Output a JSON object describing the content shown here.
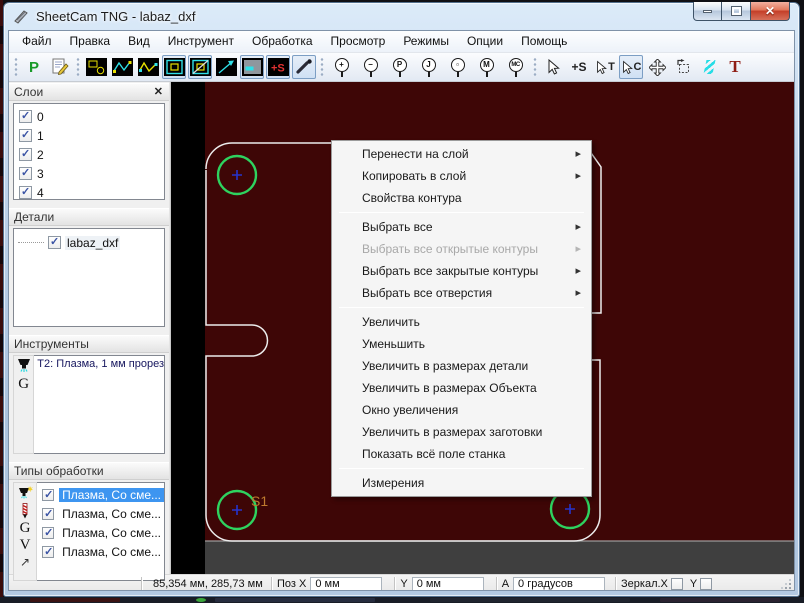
{
  "window": {
    "title": "SheetCam TNG - labaz_dxf"
  },
  "menu_bar": [
    "Файл",
    "Правка",
    "Вид",
    "Инструмент",
    "Обработка",
    "Просмотр",
    "Режимы",
    "Опции",
    "Помощь"
  ],
  "toolbar": {
    "post_label": "P",
    "pierce_s_label": "+S",
    "zoom_tools": [
      {
        "name": "zoom-in",
        "glyph": "+"
      },
      {
        "name": "zoom-out",
        "glyph": "−"
      },
      {
        "name": "zoom-part",
        "glyph": "P"
      },
      {
        "name": "zoom-job",
        "glyph": "J"
      },
      {
        "name": "zoom-window",
        "glyph": "▫"
      },
      {
        "name": "zoom-material",
        "glyph": "M"
      },
      {
        "name": "zoom-machine",
        "glyph": "MC"
      }
    ],
    "select_t_label": "T",
    "select_c_label": "C",
    "select_s_label": "+S",
    "text_tool_label": "T"
  },
  "panels": {
    "layers": {
      "title": "Слои",
      "items": [
        {
          "label": "0",
          "checked": true
        },
        {
          "label": "1",
          "checked": true
        },
        {
          "label": "2",
          "checked": true
        },
        {
          "label": "3",
          "checked": true
        },
        {
          "label": "4",
          "checked": true
        }
      ]
    },
    "parts": {
      "title": "Детали",
      "items": [
        {
          "label": "labaz_dxf",
          "checked": true
        }
      ]
    },
    "tools": {
      "title": "Инструменты",
      "g_label": "G",
      "items": [
        {
          "label": "T2: Плазма, 1 мм прорез"
        }
      ]
    },
    "operations": {
      "title": "Типы обработки",
      "g_label": "G",
      "v_label": "V",
      "arrow_label": "↗",
      "items": [
        {
          "label": "Плазма, Со сме...",
          "checked": true,
          "selected": true
        },
        {
          "label": "Плазма, Со сме...",
          "checked": true,
          "selected": false
        },
        {
          "label": "Плазма, Со сме...",
          "checked": true,
          "selected": false
        },
        {
          "label": "Плазма, Со сме...",
          "checked": true,
          "selected": false
        }
      ]
    }
  },
  "context_menu": {
    "items": [
      {
        "label": "Перенести на слой",
        "submenu": true
      },
      {
        "label": "Копировать в слой",
        "submenu": true
      },
      {
        "label": "Свойства контура",
        "submenu": false
      },
      {
        "label": "Выбрать все",
        "submenu": true
      },
      {
        "label": "Выбрать все открытые контуры",
        "submenu": true,
        "disabled": true
      },
      {
        "label": "Выбрать все закрытые контуры",
        "submenu": true
      },
      {
        "label": "Выбрать все отверстия",
        "submenu": true
      },
      {
        "label": "Увеличить",
        "submenu": false
      },
      {
        "label": "Уменьшить",
        "submenu": false
      },
      {
        "label": "Увеличить в размерах детали",
        "submenu": false
      },
      {
        "label": "Увеличить в размерах Объекта",
        "submenu": false
      },
      {
        "label": "Окно увеличения",
        "submenu": false
      },
      {
        "label": "Увеличить в размерах заготовки",
        "submenu": false
      },
      {
        "label": "Показать всё поле станка",
        "submenu": false
      },
      {
        "label": "Измерения",
        "submenu": false
      }
    ]
  },
  "canvas": {
    "start_point_label": "S1",
    "colors": {
      "material_bg": "#3e0606",
      "outside_left": "#000000",
      "outside_bottom": "#3f3f3f",
      "part_outline": "#ececec",
      "pierce_circle": "#2ed35f",
      "pierce_cross": "#2633cc",
      "start_label": "#bf7a2e"
    }
  },
  "status_bar": {
    "coords": "85,354 мм, 285,73 мм",
    "pos_label": "Поз X",
    "pos_x_value": "0 мм",
    "y_label": "Y",
    "y_value": "0 мм",
    "angle_label": "А",
    "angle_value": "0 градусов",
    "mirror_x_label": "Зеркал.X",
    "mirror_y_label": "Y"
  }
}
